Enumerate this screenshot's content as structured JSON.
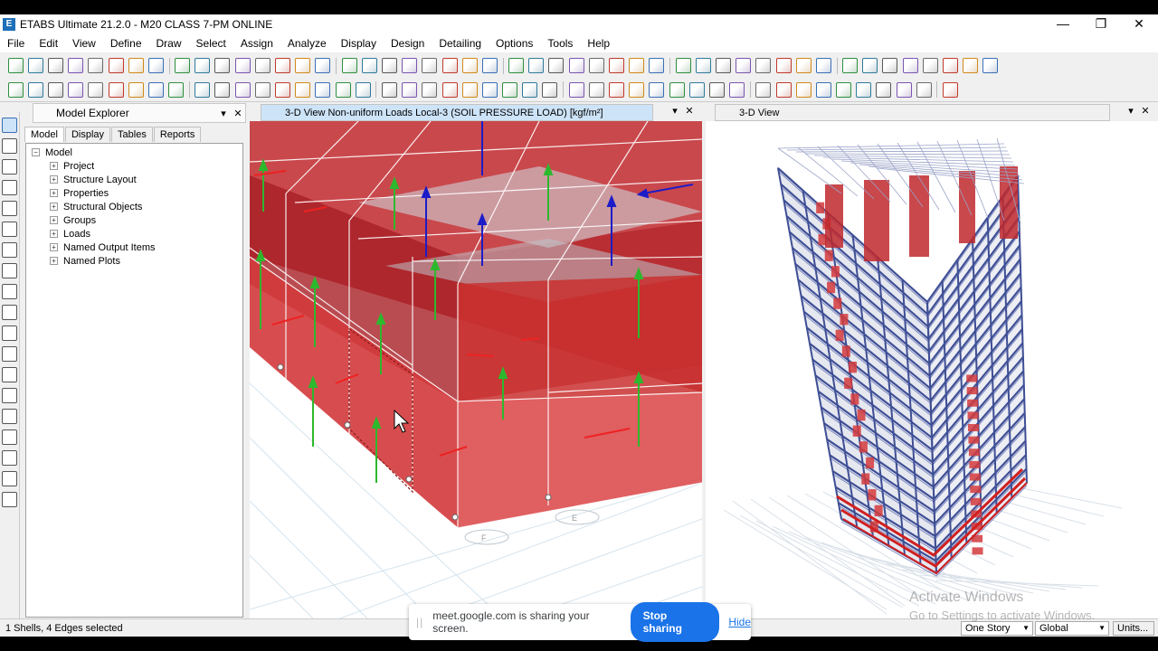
{
  "window": {
    "app_icon_letter": "E",
    "title": "ETABS Ultimate 21.2.0 - M20 CLASS 7-PM ONLINE",
    "minimize_glyph": "—",
    "restore_glyph": "❐",
    "close_glyph": "✕"
  },
  "menu": [
    "File",
    "Edit",
    "View",
    "Define",
    "Draw",
    "Select",
    "Assign",
    "Analyze",
    "Display",
    "Design",
    "Detailing",
    "Options",
    "Tools",
    "Help"
  ],
  "explorer": {
    "title": "Model Explorer",
    "dropdown_glyph": "▾",
    "close_glyph": "✕",
    "tabs": [
      "Model",
      "Display",
      "Tables",
      "Reports"
    ],
    "active_tab": "Model",
    "tree_root": "Model",
    "tree_items": [
      "Project",
      "Structure Layout",
      "Properties",
      "Structural Objects",
      "Groups",
      "Loads",
      "Named Output Items",
      "Named Plots"
    ],
    "expander_glyph": "+",
    "root_expander_glyph": "−"
  },
  "views": {
    "view1_title": "3-D View  Non-uniform Loads Local-3  (SOIL PRESSURE LOAD)  [kgf/m²]",
    "view2_title": "3-D View",
    "dropdown_glyph": "▾",
    "close_glyph": "✕",
    "gridbubble_a": "F",
    "gridbubble_b": "E"
  },
  "status": {
    "selection_text": "1 Shells, 4 Edges selected",
    "story_select": "One Story",
    "coord_select": "Global",
    "units_button": "Units..."
  },
  "meet_banner": {
    "grip": "||",
    "text": "meet.google.com is sharing your screen.",
    "stop_label": "Stop sharing",
    "hide_label": "Hide"
  },
  "watermark": {
    "line1": "Activate Windows",
    "line2": "Go to Settings to activate Windows."
  },
  "colors": {
    "slab_red": "#d9383a",
    "arrow_green": "#2db82d",
    "arrow_blue": "#1c1cc8",
    "frame_blue": "#4a5aa0",
    "meet_blue": "#1a73e8",
    "active_tab": "#cde3f7"
  },
  "toolbar_icons": [
    "new-model-icon",
    "open-icon",
    "save-icon",
    "undo-icon",
    "redo-icon",
    "pencil-icon",
    "lock-icon",
    "run-icon",
    "zoom-window-icon",
    "zoom-in-icon",
    "zoom-out-icon",
    "pan-icon",
    "3d-view-icon",
    "plan-view-icon",
    "elevation-view-icon",
    "rotate-icon"
  ]
}
